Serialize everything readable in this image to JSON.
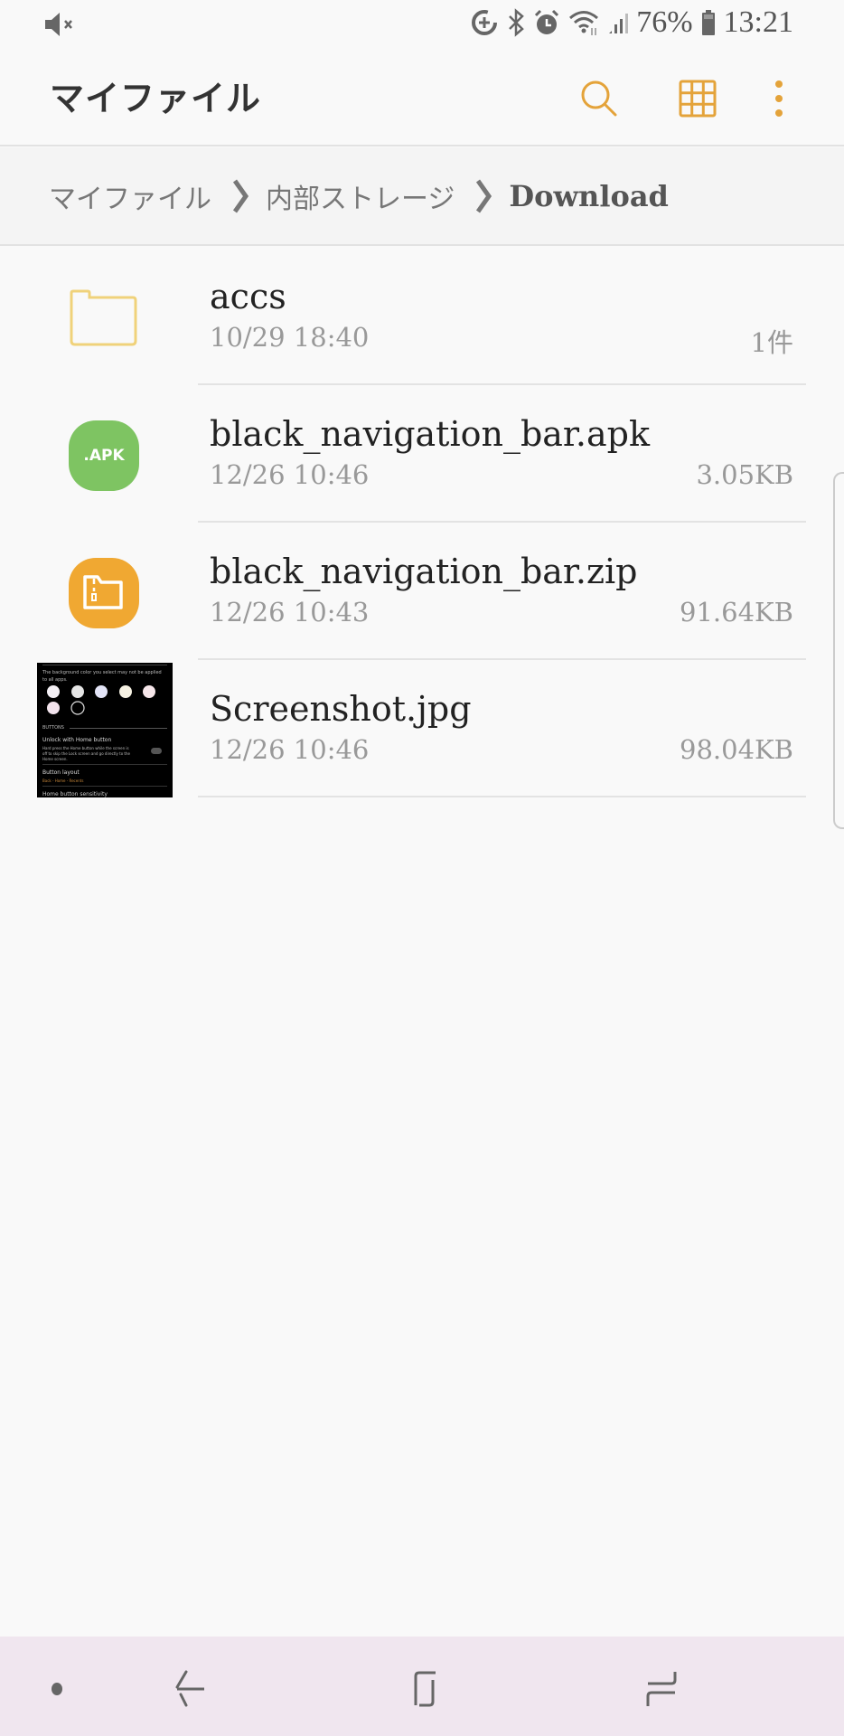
{
  "status_bar": {
    "icons": [
      "mute-icon",
      "data-saver-icon",
      "bluetooth-icon",
      "alarm-icon",
      "wifi-icon",
      "signal-icon",
      "battery-icon"
    ],
    "battery": "76%",
    "time": "13:21"
  },
  "header": {
    "title": "マイファイル",
    "actions": [
      {
        "name": "search",
        "icon": "search-icon"
      },
      {
        "name": "grid-view",
        "icon": "grid-icon"
      },
      {
        "name": "more-options",
        "icon": "more-vertical-icon"
      }
    ],
    "accent_color": "#e4a33a"
  },
  "breadcrumb": {
    "items": [
      "マイファイル",
      "内部ストレージ",
      "Download"
    ]
  },
  "files": [
    {
      "name": "accs",
      "date": "10/29 18:40",
      "size": "1件",
      "type": "folder",
      "icon": "folder-icon"
    },
    {
      "name": "black_navigation_bar.apk",
      "date": "12/26 10:46",
      "size": "3.05KB",
      "type": "apk",
      "icon": "apk-icon",
      "badge": ".APK"
    },
    {
      "name": "black_navigation_bar.zip",
      "date": "12/26 10:43",
      "size": "91.64KB",
      "type": "zip",
      "icon": "zip-icon"
    },
    {
      "name": "Screenshot.jpg",
      "date": "12/26 10:46",
      "size": "98.04KB",
      "type": "image",
      "icon": "image-thumbnail",
      "thumbnail": {
        "line1": "The background color you select may not be applied",
        "line2": "to all apps.",
        "section": "BUTTONS",
        "setting1_title": "Unlock with Home button",
        "setting1_desc1": "Hard press the Home button while the screen is",
        "setting1_desc2": "off to skip the Lock screen and go directly to the",
        "setting1_desc3": "Home screen.",
        "setting2_title": "Button layout",
        "setting2_value": "Back - Home - Recents",
        "setting3_title": "Home button sensitivity"
      }
    }
  ],
  "nav_bar": {
    "buttons": [
      "hide-keyboard-dot",
      "back",
      "home",
      "recents"
    ]
  }
}
